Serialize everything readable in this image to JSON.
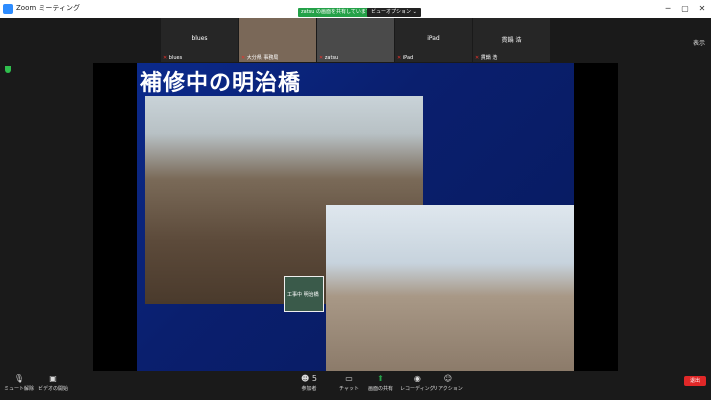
{
  "window": {
    "title": "Zoom ミーティング",
    "share_notice": "zatsu の画面を共有しています",
    "view_options": "ビューオプション ⌄",
    "minimize": "─",
    "maximize": "▢",
    "close": "✕"
  },
  "participants": [
    {
      "center": "blues",
      "tag": "blues"
    },
    {
      "center": "",
      "tag": "大分県 事務局"
    },
    {
      "center": "",
      "tag": "zatsu"
    },
    {
      "center": "iPad",
      "tag": "iPad"
    },
    {
      "center": "貫鍋 浩",
      "tag": "貫鍋 浩"
    }
  ],
  "view_button": "表示",
  "slide": {
    "title": "補修中の明治橋",
    "sign_text": "工事中 明治橋"
  },
  "toolbar": {
    "mute": "ミュート解除",
    "video": "ビデオの開始",
    "participants": "参加者",
    "participants_count": "5",
    "chat": "チャット",
    "share": "画面の共有",
    "record": "レコーディング",
    "reactions": "リアクション",
    "end": "退出"
  },
  "colors": {
    "share_green": "#24a148",
    "end_red": "#e02828",
    "slide_blue": "#0b2a8c"
  }
}
